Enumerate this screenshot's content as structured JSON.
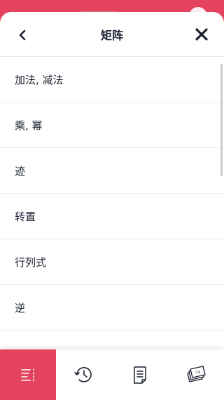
{
  "header": {
    "title": "矩阵",
    "back_icon": "chevron-left-icon",
    "close_icon": "close-icon"
  },
  "list": {
    "items": [
      {
        "label": "加法, 减法"
      },
      {
        "label": "乘, 幂"
      },
      {
        "label": "迹"
      },
      {
        "label": "转置"
      },
      {
        "label": "行列式"
      },
      {
        "label": "逆"
      }
    ]
  },
  "tabbar": {
    "tabs": [
      {
        "icon": "list-icon",
        "active": true
      },
      {
        "icon": "history-icon",
        "active": false
      },
      {
        "icon": "document-icon",
        "active": false
      },
      {
        "icon": "formula-cards-icon",
        "active": false
      }
    ]
  },
  "colors": {
    "accent": "#e5435d",
    "text": "#1c2130",
    "divider": "#e9ecf0"
  }
}
